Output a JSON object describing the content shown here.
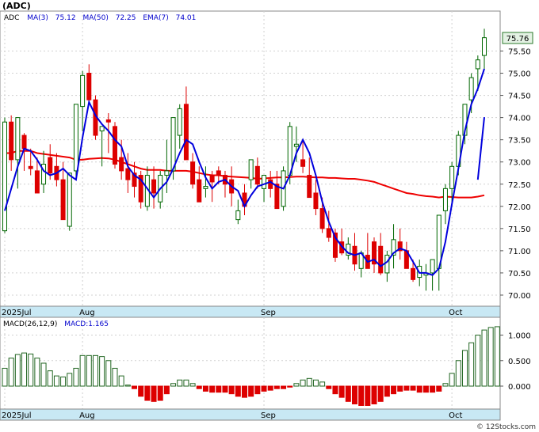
{
  "header": {
    "ticker": "(ADC)",
    "legend": [
      {
        "label": "ADC",
        "color": "#000000"
      },
      {
        "label": "MA(3)",
        "value": "75.12",
        "color": "#0000cc"
      },
      {
        "label": "MA(50)",
        "value": "72.25",
        "color": "#0000cc"
      },
      {
        "label": "EMA(7)",
        "value": "74.01",
        "color": "#0000cc"
      }
    ],
    "last_price": "75.76"
  },
  "macd": {
    "label": "MACD(26,12,9)",
    "value_label": "MACD:1.165"
  },
  "watermark": "© 12Stocks.com",
  "colors": {
    "up": "#006600",
    "down": "#dd0000",
    "ma_fast": "#0000dd",
    "ma_slow": "#ee0000",
    "axis_band": "#c8e8f4",
    "grid": "#d0d0d0",
    "macd_pos": "#226622",
    "macd_neg": "#dd0000"
  },
  "chart_data": [
    {
      "type": "candlestick",
      "title": "(ADC)",
      "x_labels": [
        "2025Jul",
        "Aug",
        "Sep",
        "Oct"
      ],
      "x_label_index": [
        0,
        12,
        40,
        69
      ],
      "ylim": [
        69.75,
        76.4
      ],
      "y_ticks": [
        "70.00",
        "70.50",
        "71.00",
        "71.50",
        "72.00",
        "72.50",
        "73.00",
        "73.50",
        "74.00",
        "74.50",
        "75.00",
        "75.50"
      ],
      "grid": true,
      "candles": [
        [
          71.45,
          74.0,
          71.4,
          73.9
        ],
        [
          73.9,
          74.05,
          72.8,
          73.05
        ],
        [
          73.05,
          74.0,
          72.4,
          74.0
        ],
        [
          73.6,
          73.65,
          72.8,
          73.3
        ],
        [
          72.9,
          73.3,
          72.7,
          72.85
        ],
        [
          72.8,
          73.1,
          72.35,
          72.3
        ],
        [
          72.5,
          73.25,
          72.3,
          72.95
        ],
        [
          73.1,
          73.4,
          72.6,
          72.75
        ],
        [
          72.9,
          73.2,
          72.45,
          72.6
        ],
        [
          72.6,
          73.0,
          72.1,
          71.7
        ],
        [
          71.55,
          72.7,
          71.45,
          72.75
        ],
        [
          72.8,
          74.2,
          72.6,
          74.3
        ],
        [
          74.25,
          75.05,
          73.7,
          74.95
        ],
        [
          75.0,
          75.2,
          74.3,
          74.4
        ],
        [
          74.4,
          74.5,
          73.5,
          73.6
        ],
        [
          73.7,
          73.75,
          72.9,
          73.8
        ],
        [
          73.95,
          74.1,
          73.2,
          73.9
        ],
        [
          73.8,
          73.9,
          72.85,
          72.95
        ],
        [
          73.1,
          73.5,
          72.6,
          72.8
        ],
        [
          72.85,
          73.2,
          72.3,
          72.6
        ],
        [
          72.75,
          73.0,
          72.2,
          72.45
        ],
        [
          72.7,
          72.8,
          71.95,
          72.1
        ],
        [
          72.0,
          72.9,
          71.9,
          72.7
        ],
        [
          72.6,
          72.9,
          71.95,
          72.3
        ],
        [
          72.1,
          72.8,
          71.95,
          72.7
        ],
        [
          72.7,
          73.5,
          72.3,
          72.8
        ],
        [
          72.8,
          74.0,
          72.6,
          74.0
        ],
        [
          73.6,
          74.3,
          73.3,
          74.2
        ],
        [
          74.3,
          74.7,
          73.1,
          73.05
        ],
        [
          73.0,
          73.2,
          72.4,
          72.5
        ],
        [
          72.6,
          72.9,
          72.2,
          72.1
        ],
        [
          72.4,
          72.9,
          72.2,
          72.45
        ],
        [
          72.7,
          72.8,
          72.1,
          72.55
        ],
        [
          72.8,
          72.9,
          72.5,
          72.7
        ],
        [
          72.7,
          72.8,
          72.2,
          72.5
        ],
        [
          72.6,
          72.9,
          72.0,
          72.3
        ],
        [
          71.7,
          72.15,
          71.6,
          71.9
        ],
        [
          72.3,
          72.5,
          71.8,
          72.0
        ],
        [
          72.6,
          73.0,
          72.4,
          73.05
        ],
        [
          72.9,
          73.1,
          72.4,
          72.5
        ],
        [
          72.4,
          72.7,
          72.1,
          72.7
        ],
        [
          72.6,
          72.8,
          72.2,
          72.4
        ],
        [
          72.5,
          72.8,
          72.0,
          71.95
        ],
        [
          72.0,
          72.9,
          71.9,
          72.8
        ],
        [
          72.7,
          73.9,
          72.5,
          73.8
        ],
        [
          73.35,
          73.8,
          73.0,
          73.4
        ],
        [
          73.05,
          73.5,
          72.75,
          72.9
        ],
        [
          72.7,
          73.1,
          72.3,
          72.2
        ],
        [
          72.3,
          72.6,
          71.8,
          71.95
        ],
        [
          71.95,
          72.2,
          71.4,
          71.5
        ],
        [
          71.5,
          71.9,
          71.2,
          71.3
        ],
        [
          71.4,
          71.5,
          70.75,
          70.85
        ],
        [
          71.2,
          71.5,
          70.9,
          70.95
        ],
        [
          70.9,
          71.3,
          70.8,
          71.15
        ],
        [
          71.1,
          71.4,
          70.55,
          70.7
        ],
        [
          70.6,
          71.0,
          70.4,
          70.95
        ],
        [
          70.9,
          71.4,
          70.6,
          70.6
        ],
        [
          71.2,
          71.3,
          70.5,
          70.7
        ],
        [
          71.1,
          71.4,
          70.45,
          70.5
        ],
        [
          70.5,
          71.0,
          70.3,
          70.9
        ],
        [
          70.9,
          71.6,
          70.6,
          71.25
        ],
        [
          71.2,
          71.5,
          70.8,
          71.0
        ],
        [
          71.0,
          71.2,
          70.6,
          70.6
        ],
        [
          70.6,
          70.8,
          70.3,
          70.35
        ],
        [
          70.4,
          70.8,
          70.2,
          70.65
        ],
        [
          70.45,
          70.7,
          70.1,
          70.5
        ],
        [
          70.5,
          70.8,
          70.1,
          70.8
        ],
        [
          70.6,
          71.2,
          70.1,
          71.8
        ],
        [
          71.9,
          72.5,
          71.6,
          72.4
        ],
        [
          72.4,
          73.0,
          72.0,
          72.9
        ],
        [
          72.9,
          73.7,
          72.7,
          73.6
        ],
        [
          73.6,
          74.3,
          73.4,
          74.3
        ],
        [
          74.4,
          75.0,
          74.1,
          74.9
        ],
        [
          75.1,
          75.4,
          74.6,
          75.3
        ],
        [
          75.4,
          76.0,
          75.1,
          75.8
        ]
      ],
      "ma3": [
        71.9,
        72.4,
        72.9,
        73.3,
        73.25,
        73.05,
        72.8,
        72.7,
        72.75,
        72.85,
        72.7,
        72.6,
        73.55,
        74.35,
        74.05,
        73.85,
        73.7,
        73.5,
        73.35,
        72.9,
        72.7,
        72.6,
        72.4,
        72.2,
        72.4,
        72.55,
        72.85,
        73.2,
        73.5,
        73.4,
        73.0,
        72.65,
        72.4,
        72.55,
        72.6,
        72.45,
        72.35,
        72.0,
        72.25,
        72.45,
        72.5,
        72.55,
        72.45,
        72.4,
        72.7,
        73.2,
        73.5,
        73.2,
        72.7,
        72.1,
        71.65,
        71.3,
        71.1,
        70.95,
        70.9,
        70.95,
        70.75,
        70.8,
        70.65,
        70.75,
        70.95,
        71.05,
        71.0,
        70.75,
        70.5,
        70.5,
        70.45,
        70.6,
        71.2,
        72.05,
        72.85,
        73.7,
        74.3,
        74.65,
        75.1
      ],
      "ma50": [
        73.2,
        73.2,
        73.25,
        73.25,
        73.25,
        73.2,
        73.18,
        73.16,
        73.14,
        73.12,
        73.1,
        73.05,
        73.05,
        73.07,
        73.08,
        73.09,
        73.08,
        73.05,
        73.0,
        72.95,
        72.9,
        72.85,
        72.82,
        72.82,
        72.82,
        72.8,
        72.8,
        72.8,
        72.8,
        72.78,
        72.75,
        72.72,
        72.7,
        72.7,
        72.68,
        72.67,
        72.66,
        72.65,
        72.64,
        72.62,
        72.63,
        72.64,
        72.65,
        72.65,
        72.66,
        72.67,
        72.67,
        72.66,
        72.65,
        72.65,
        72.64,
        72.64,
        72.63,
        72.62,
        72.62,
        72.6,
        72.58,
        72.55,
        72.5,
        72.45,
        72.4,
        72.35,
        72.3,
        72.28,
        72.25,
        72.23,
        72.22,
        72.2,
        72.22,
        72.21,
        72.2,
        72.2,
        72.2,
        72.22,
        72.25
      ],
      "ema7": [
        null,
        null,
        null,
        null,
        null,
        null,
        null,
        null,
        null,
        null,
        null,
        null,
        null,
        null,
        null,
        null,
        null,
        null,
        null,
        null,
        null,
        null,
        null,
        null,
        null,
        null,
        null,
        null,
        null,
        null,
        null,
        null,
        null,
        null,
        null,
        null,
        null,
        null,
        null,
        null,
        null,
        null,
        null,
        null,
        null,
        null,
        null,
        null,
        null,
        null,
        null,
        null,
        null,
        null,
        null,
        null,
        null,
        null,
        null,
        null,
        null,
        null,
        null,
        null,
        null,
        null,
        null,
        null,
        null,
        null,
        null,
        null,
        null,
        72.6,
        74.01
      ]
    },
    {
      "type": "bar",
      "title": "MACD(26,12,9)",
      "ylim": [
        -0.45,
        1.35
      ],
      "y_ticks": [
        "0.000",
        "0.500",
        "1.000"
      ],
      "x_labels": [
        "2025Jul",
        "Aug",
        "Sep",
        "Oct"
      ],
      "x_label_index": [
        0,
        12,
        40,
        69
      ],
      "values": [
        0.35,
        0.55,
        0.62,
        0.65,
        0.63,
        0.55,
        0.45,
        0.3,
        0.2,
        0.18,
        0.25,
        0.35,
        0.6,
        0.6,
        0.6,
        0.58,
        0.5,
        0.35,
        0.2,
        0.02,
        -0.05,
        -0.2,
        -0.28,
        -0.3,
        -0.28,
        -0.15,
        0.05,
        0.12,
        0.12,
        0.05,
        -0.05,
        -0.1,
        -0.12,
        -0.12,
        -0.12,
        -0.15,
        -0.2,
        -0.22,
        -0.2,
        -0.15,
        -0.1,
        -0.08,
        -0.05,
        -0.05,
        -0.02,
        0.05,
        0.12,
        0.15,
        0.12,
        0.08,
        -0.05,
        -0.15,
        -0.22,
        -0.3,
        -0.35,
        -0.38,
        -0.38,
        -0.35,
        -0.3,
        -0.2,
        -0.15,
        -0.1,
        -0.08,
        -0.08,
        -0.12,
        -0.12,
        -0.12,
        -0.1,
        0.05,
        0.25,
        0.5,
        0.7,
        0.85,
        1.0,
        1.1,
        1.15,
        1.165
      ]
    }
  ]
}
